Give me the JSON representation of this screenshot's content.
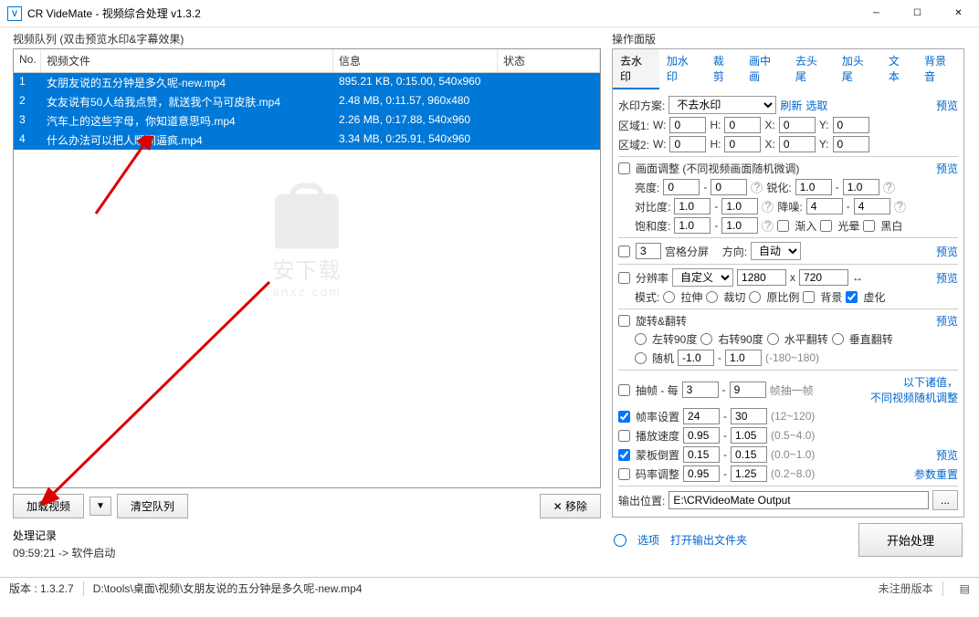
{
  "window": {
    "title": "CR VideMate - 视频综合处理 v1.3.2"
  },
  "leftPanelTitle": "视频队列 (双击预览水印&字幕效果)",
  "table": {
    "headers": {
      "no": "No.",
      "file": "视频文件",
      "info": "信息",
      "status": "状态"
    },
    "rows": [
      {
        "no": "1",
        "file": "女朋友说的五分钟是多久呢-new.mp4",
        "info": "895.21 KB, 0:15.00, 540x960"
      },
      {
        "no": "2",
        "file": "女友说有50人给我点赞，就送我个马可皮肤.mp4",
        "info": "2.48 MB, 0:11.57, 960x480"
      },
      {
        "no": "3",
        "file": "汽车上的这些字母，你知道意思吗.mp4",
        "info": "2.26 MB, 0:17.88, 540x960"
      },
      {
        "no": "4",
        "file": "什么办法可以把人瞬间逼疯.mp4",
        "info": "3.34 MB, 0:25.91, 540x960"
      }
    ]
  },
  "watermark": {
    "text": "安下载",
    "sub": "anxz.com"
  },
  "leftButtons": {
    "add": "加载视频",
    "clear": "清空队列",
    "remove": "移除"
  },
  "rightPanelTitle": "操作面版",
  "tabs": [
    "去水印",
    "加水印",
    "裁剪",
    "画中画",
    "去头尾",
    "加头尾",
    "文本",
    "背景音"
  ],
  "wm": {
    "schemeLabel": "水印方案:",
    "scheme": "不去水印",
    "refresh": "刷新",
    "select": "选取",
    "preview": "预览",
    "area1": "区域1:",
    "area2": "区域2:",
    "W": "W:",
    "H": "H:",
    "X": "X:",
    "Y": "Y:",
    "zero": "0"
  },
  "adjust": {
    "title": "画面调整 (不同视频画面随机微调)",
    "preview": "预览",
    "bright": "亮度:",
    "sharp": "锐化:",
    "contrast": "对比度:",
    "noise": "降噪:",
    "sat": "饱和度:",
    "v0": "0",
    "v10": "1.0",
    "v4": "4",
    "in": "渐入",
    "glow": "光晕",
    "bw": "黑白"
  },
  "grid": {
    "val": "3",
    "label": "宫格分屏",
    "dir": "方向:",
    "auto": "自动",
    "preview": "预览"
  },
  "res": {
    "label": "分辨率",
    "custom": "自定义",
    "w": "1280",
    "x": "x",
    "h": "720",
    "preview": "预览",
    "modeLabel": "模式:",
    "stretch": "拉伸",
    "crop": "裁切",
    "orig": "原比例",
    "bg": "背景",
    "blur": "虚化"
  },
  "rotate": {
    "label": "旋转&翻转",
    "preview": "预览",
    "l90": "左转90度",
    "r90": "右转90度",
    "hflip": "水平翻转",
    "vflip": "垂直翻转",
    "rand": "随机",
    "v1": "-1.0",
    "v2": "1.0",
    "range": "(-180~180)"
  },
  "frame": {
    "drop": "抽帧 - 每",
    "d1": "3",
    "d2": "9",
    "unit": "帧抽一帧",
    "note1": "以下诸值，",
    "note2": "不同视频随机调整",
    "fps": "帧率设置",
    "f1": "24",
    "f2": "30",
    "frange": "(12~120)",
    "speed": "播放速度",
    "s1": "0.95",
    "s2": "1.05",
    "srange": "(0.5~4.0)",
    "mask": "蒙板倒置",
    "m1": "0.15",
    "m2": "0.15",
    "mrange": "(0.0~1.0)",
    "mpv": "预览",
    "rate": "码率调整",
    "r1": "0.95",
    "r2": "1.25",
    "rrange": "(0.2~8.0)",
    "reset": "参数重置"
  },
  "output": {
    "label": "输出位置:",
    "path": "E:\\CRVideoMate Output"
  },
  "footer": {
    "options": "选项",
    "openOut": "打开输出文件夹",
    "start": "开始处理"
  },
  "log": {
    "title": "处理记录",
    "line": "09:59:21 -> 软件启动"
  },
  "status": {
    "ver": "版本 : 1.3.2.7",
    "path": "D:\\tools\\桌面\\视频\\女朋友说的五分钟是多久呢-new.mp4",
    "reg": "未注册版本"
  }
}
